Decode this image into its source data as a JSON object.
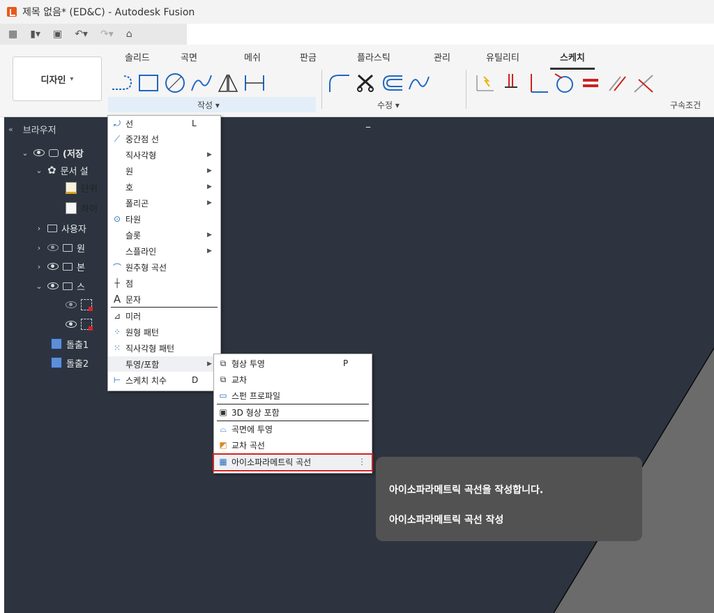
{
  "window": {
    "title": "제목 없음* (ED&C) - Autodesk Fusion"
  },
  "ribbon": {
    "workspace": "디자인",
    "tabs": [
      "솔리드",
      "곡면",
      "메쉬",
      "판금",
      "플라스틱",
      "관리",
      "유틸리티",
      "스케치"
    ],
    "active_tab": "스케치",
    "groups": {
      "create": "작성",
      "modify": "수정",
      "constraints": "구속조건"
    }
  },
  "browser": {
    "title": "브라우저",
    "rows": [
      {
        "label": "(저장"
      },
      {
        "label": "문서 설"
      },
      {
        "label": "단위"
      },
      {
        "label": "하이"
      },
      {
        "label": "사용자"
      },
      {
        "label": "원"
      },
      {
        "label": "본"
      },
      {
        "label": "스"
      },
      {
        "label": ""
      },
      {
        "label": ""
      },
      {
        "label": "돌출1"
      },
      {
        "label": "돌출2"
      }
    ]
  },
  "create_menu": {
    "items": [
      {
        "label": "선",
        "shortcut": "L"
      },
      {
        "label": "중간점 선"
      },
      {
        "label": "직사각형"
      },
      {
        "label": "원"
      },
      {
        "label": "호"
      },
      {
        "label": "폴리곤"
      },
      {
        "label": "타원"
      },
      {
        "label": "슬롯"
      },
      {
        "label": "스플라인"
      },
      {
        "label": "원추형 곡선"
      },
      {
        "label": "점"
      },
      {
        "label": "문자"
      },
      {
        "label": "미러"
      },
      {
        "label": "원형 패턴"
      },
      {
        "label": "직사각형 패턴"
      },
      {
        "label": "투영/포함"
      },
      {
        "label": "스케치 치수",
        "shortcut": "D"
      }
    ]
  },
  "project_menu": {
    "items": [
      {
        "label": "형상 투영",
        "shortcut": "P"
      },
      {
        "label": "교차"
      },
      {
        "label": "스펀 프로파일"
      },
      {
        "label": "3D 형상 포함"
      },
      {
        "label": "곡면에 투영"
      },
      {
        "label": "교차 곡선"
      },
      {
        "label": "아이소파라메트릭 곡선"
      }
    ]
  },
  "tooltip": {
    "description": "아이소파라메트릭 곡선을 작성합니다.",
    "name": "아이소파라메트릭 곡선 작성"
  },
  "colors": {
    "viewport": "#2d3440",
    "highlight": "#d32424",
    "tooltip_bg": "#525252"
  }
}
